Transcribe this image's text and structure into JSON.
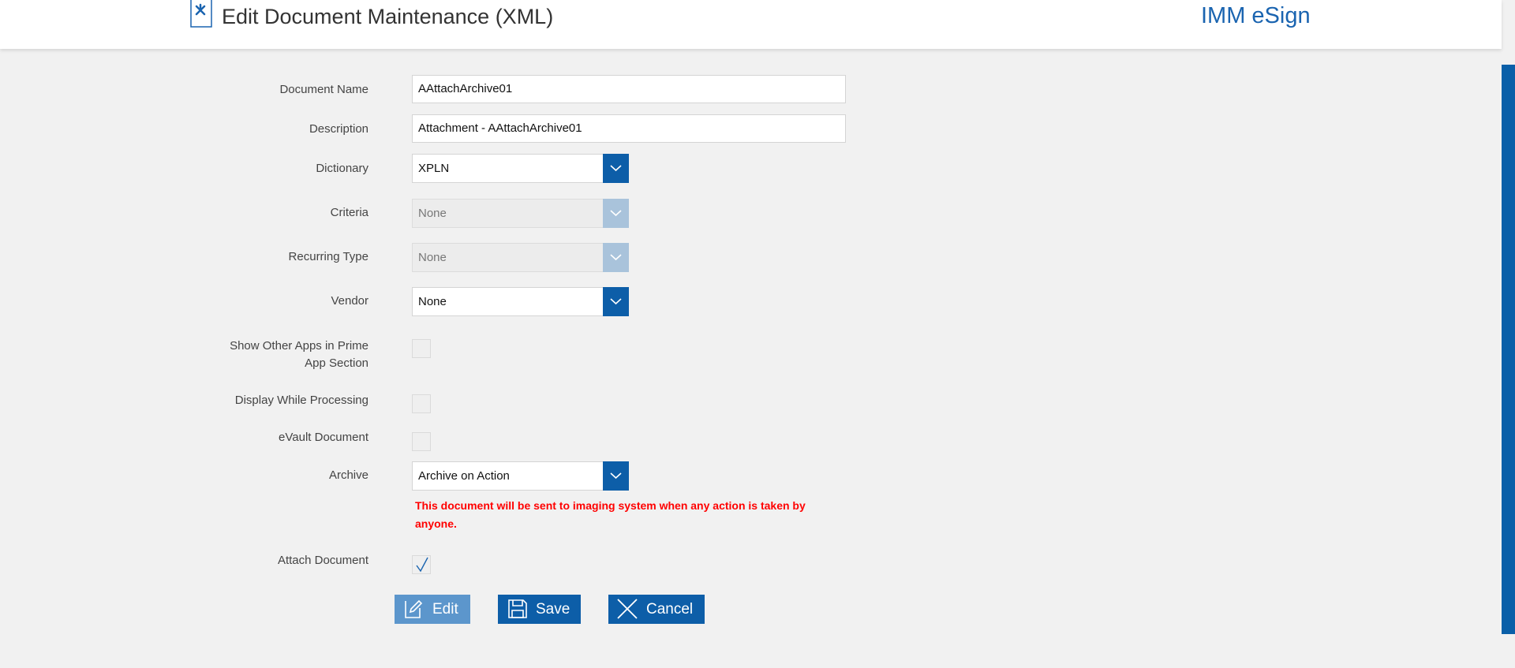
{
  "header": {
    "title": "Edit Document Maintenance (XML)",
    "brand": "IMM eSign"
  },
  "form": {
    "document_name": {
      "label": "Document Name",
      "value": "AAttachArchive01"
    },
    "description": {
      "label": "Description",
      "value": "Attachment  - AAttachArchive01"
    },
    "dictionary": {
      "label": "Dictionary",
      "value": "XPLN"
    },
    "criteria": {
      "label": "Criteria",
      "value": "None"
    },
    "recurring_type": {
      "label": "Recurring Type",
      "value": "None"
    },
    "vendor": {
      "label": "Vendor",
      "value": "None"
    },
    "show_other_apps": {
      "label_line1": "Show Other Apps in Prime",
      "label_line2": "App Section",
      "checked": false
    },
    "display_while_processing": {
      "label": "Display While Processing",
      "checked": false
    },
    "evault_document": {
      "label": "eVault Document",
      "checked": false
    },
    "archive": {
      "label": "Archive",
      "value": "Archive on Action",
      "warning": "This document will be sent to imaging system when any action is taken by anyone."
    },
    "attach_document": {
      "label": "Attach Document",
      "checked": true
    }
  },
  "buttons": {
    "edit": "Edit",
    "save": "Save",
    "cancel": "Cancel"
  },
  "colors": {
    "primary": "#0d5ea8",
    "brand": "#1a64b0",
    "warning": "#ff0000",
    "disabled_button": "#5c96cc"
  }
}
